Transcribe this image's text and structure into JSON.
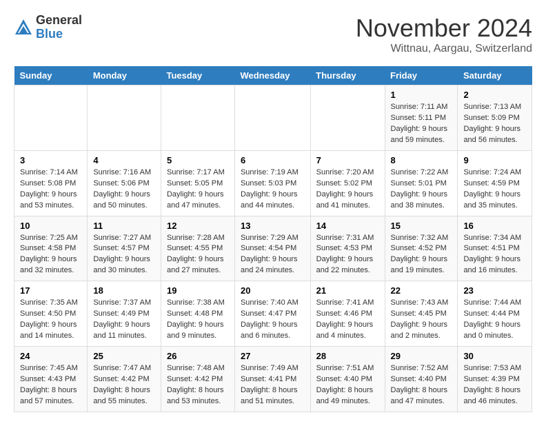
{
  "logo": {
    "general": "General",
    "blue": "Blue"
  },
  "header": {
    "month_title": "November 2024",
    "location": "Wittnau, Aargau, Switzerland"
  },
  "weekdays": [
    "Sunday",
    "Monday",
    "Tuesday",
    "Wednesday",
    "Thursday",
    "Friday",
    "Saturday"
  ],
  "weeks": [
    [
      {
        "day": "",
        "info": ""
      },
      {
        "day": "",
        "info": ""
      },
      {
        "day": "",
        "info": ""
      },
      {
        "day": "",
        "info": ""
      },
      {
        "day": "",
        "info": ""
      },
      {
        "day": "1",
        "info": "Sunrise: 7:11 AM\nSunset: 5:11 PM\nDaylight: 9 hours and 59 minutes."
      },
      {
        "day": "2",
        "info": "Sunrise: 7:13 AM\nSunset: 5:09 PM\nDaylight: 9 hours and 56 minutes."
      }
    ],
    [
      {
        "day": "3",
        "info": "Sunrise: 7:14 AM\nSunset: 5:08 PM\nDaylight: 9 hours and 53 minutes."
      },
      {
        "day": "4",
        "info": "Sunrise: 7:16 AM\nSunset: 5:06 PM\nDaylight: 9 hours and 50 minutes."
      },
      {
        "day": "5",
        "info": "Sunrise: 7:17 AM\nSunset: 5:05 PM\nDaylight: 9 hours and 47 minutes."
      },
      {
        "day": "6",
        "info": "Sunrise: 7:19 AM\nSunset: 5:03 PM\nDaylight: 9 hours and 44 minutes."
      },
      {
        "day": "7",
        "info": "Sunrise: 7:20 AM\nSunset: 5:02 PM\nDaylight: 9 hours and 41 minutes."
      },
      {
        "day": "8",
        "info": "Sunrise: 7:22 AM\nSunset: 5:01 PM\nDaylight: 9 hours and 38 minutes."
      },
      {
        "day": "9",
        "info": "Sunrise: 7:24 AM\nSunset: 4:59 PM\nDaylight: 9 hours and 35 minutes."
      }
    ],
    [
      {
        "day": "10",
        "info": "Sunrise: 7:25 AM\nSunset: 4:58 PM\nDaylight: 9 hours and 32 minutes."
      },
      {
        "day": "11",
        "info": "Sunrise: 7:27 AM\nSunset: 4:57 PM\nDaylight: 9 hours and 30 minutes."
      },
      {
        "day": "12",
        "info": "Sunrise: 7:28 AM\nSunset: 4:55 PM\nDaylight: 9 hours and 27 minutes."
      },
      {
        "day": "13",
        "info": "Sunrise: 7:29 AM\nSunset: 4:54 PM\nDaylight: 9 hours and 24 minutes."
      },
      {
        "day": "14",
        "info": "Sunrise: 7:31 AM\nSunset: 4:53 PM\nDaylight: 9 hours and 22 minutes."
      },
      {
        "day": "15",
        "info": "Sunrise: 7:32 AM\nSunset: 4:52 PM\nDaylight: 9 hours and 19 minutes."
      },
      {
        "day": "16",
        "info": "Sunrise: 7:34 AM\nSunset: 4:51 PM\nDaylight: 9 hours and 16 minutes."
      }
    ],
    [
      {
        "day": "17",
        "info": "Sunrise: 7:35 AM\nSunset: 4:50 PM\nDaylight: 9 hours and 14 minutes."
      },
      {
        "day": "18",
        "info": "Sunrise: 7:37 AM\nSunset: 4:49 PM\nDaylight: 9 hours and 11 minutes."
      },
      {
        "day": "19",
        "info": "Sunrise: 7:38 AM\nSunset: 4:48 PM\nDaylight: 9 hours and 9 minutes."
      },
      {
        "day": "20",
        "info": "Sunrise: 7:40 AM\nSunset: 4:47 PM\nDaylight: 9 hours and 6 minutes."
      },
      {
        "day": "21",
        "info": "Sunrise: 7:41 AM\nSunset: 4:46 PM\nDaylight: 9 hours and 4 minutes."
      },
      {
        "day": "22",
        "info": "Sunrise: 7:43 AM\nSunset: 4:45 PM\nDaylight: 9 hours and 2 minutes."
      },
      {
        "day": "23",
        "info": "Sunrise: 7:44 AM\nSunset: 4:44 PM\nDaylight: 9 hours and 0 minutes."
      }
    ],
    [
      {
        "day": "24",
        "info": "Sunrise: 7:45 AM\nSunset: 4:43 PM\nDaylight: 8 hours and 57 minutes."
      },
      {
        "day": "25",
        "info": "Sunrise: 7:47 AM\nSunset: 4:42 PM\nDaylight: 8 hours and 55 minutes."
      },
      {
        "day": "26",
        "info": "Sunrise: 7:48 AM\nSunset: 4:42 PM\nDaylight: 8 hours and 53 minutes."
      },
      {
        "day": "27",
        "info": "Sunrise: 7:49 AM\nSunset: 4:41 PM\nDaylight: 8 hours and 51 minutes."
      },
      {
        "day": "28",
        "info": "Sunrise: 7:51 AM\nSunset: 4:40 PM\nDaylight: 8 hours and 49 minutes."
      },
      {
        "day": "29",
        "info": "Sunrise: 7:52 AM\nSunset: 4:40 PM\nDaylight: 8 hours and 47 minutes."
      },
      {
        "day": "30",
        "info": "Sunrise: 7:53 AM\nSunset: 4:39 PM\nDaylight: 8 hours and 46 minutes."
      }
    ]
  ]
}
